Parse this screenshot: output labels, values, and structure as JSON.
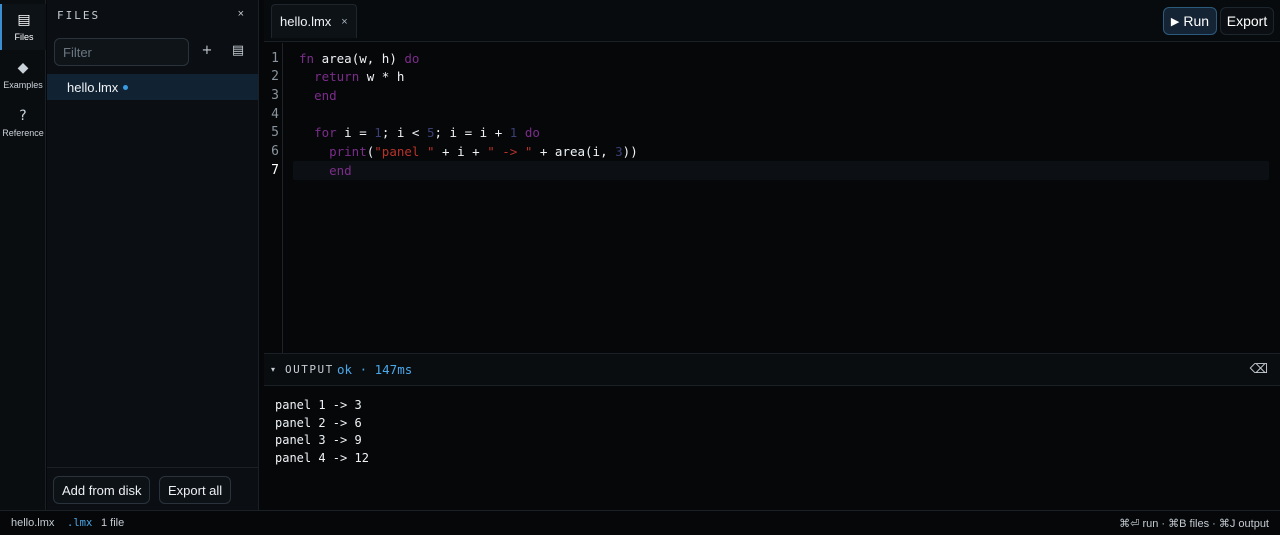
{
  "activity": [
    {
      "label": "Files",
      "icon": "files-icon",
      "glyph": "▤"
    },
    {
      "label": "Examples",
      "icon": "diamond-icon",
      "glyph": "◆"
    },
    {
      "label": "Reference",
      "icon": "help-icon",
      "glyph": "?"
    }
  ],
  "files_panel": {
    "title": "FILES",
    "close_glyph": "×",
    "filter_placeholder": "Filter",
    "new_glyph": "+",
    "menu_glyph": "▤",
    "items": [
      {
        "name": "hello.lmx",
        "modified": true
      }
    ],
    "add_from_disk": "Add from disk",
    "export_all": "Export all"
  },
  "tabs": [
    {
      "name": "hello.lmx",
      "close_glyph": "×"
    }
  ],
  "toolbar": {
    "run_glyph": "▶",
    "run_label": "Run",
    "export_label": "Export"
  },
  "editor": {
    "current_line": 7,
    "lines": [
      {
        "n": "1",
        "code": "fn area(w, h) do"
      },
      {
        "n": "2",
        "code": "  return w * h"
      },
      {
        "n": "3",
        "code": "  end"
      },
      {
        "n": "4",
        "code": ""
      },
      {
        "n": "5",
        "code": "  for i = 1; i < 5; i = i + 1 do"
      },
      {
        "n": "6",
        "code": "    print(\"panel \" + i + \" -> \" + area(i, 3))"
      },
      {
        "n": "7",
        "code": "    end"
      }
    ]
  },
  "output": {
    "caret": "▾",
    "title": "OUTPUT",
    "status": "ok · 147ms",
    "clear_glyph": "⌫",
    "lines": [
      "panel 1 -> 3",
      "panel 2 -> 6",
      "panel 3 -> 9",
      "panel 4 -> 12"
    ]
  },
  "statusbar": {
    "file": "hello.lmx",
    "lang": ".lmx",
    "count": "1 file",
    "shortcuts": "⌘⏎ run · ⌘B files · ⌘J output"
  },
  "colors": {
    "accent": "#3b8fd1",
    "keyword": "#7b2d8a",
    "string": "#b8322a",
    "number": "#3b3f74",
    "status_ok": "#4aa7e8"
  }
}
